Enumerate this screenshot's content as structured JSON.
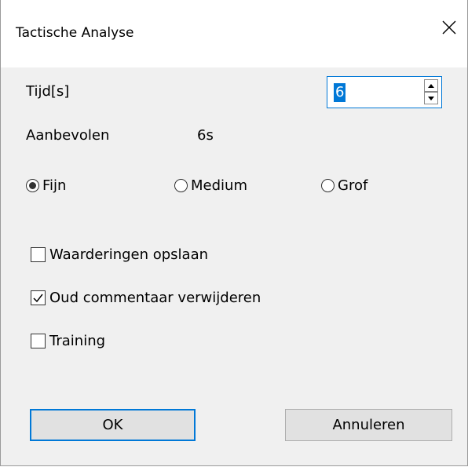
{
  "window": {
    "title": "Tactische Analyse"
  },
  "time": {
    "label": "Tijd[s]",
    "value": "6"
  },
  "recommended": {
    "label": "Aanbevolen",
    "value": "6s"
  },
  "granularity": {
    "options": [
      {
        "label": "Fijn",
        "checked": true
      },
      {
        "label": "Medium",
        "checked": false
      },
      {
        "label": "Grof",
        "checked": false
      }
    ]
  },
  "options": {
    "save_ratings": {
      "label": "Waarderingen opslaan",
      "checked": false
    },
    "remove_old_comments": {
      "label": "Oud commentaar verwijderen",
      "checked": true
    },
    "training": {
      "label": "Training",
      "checked": false
    }
  },
  "buttons": {
    "ok": "OK",
    "cancel": "Annuleren"
  },
  "colors": {
    "accent": "#0078d7",
    "dialog_bg": "#f0f0f0",
    "button_bg": "#e1e1e1"
  },
  "icons": {
    "close": "close-icon",
    "spin_up": "chevron-up-icon",
    "spin_down": "chevron-down-icon",
    "check": "checkmark-icon"
  }
}
